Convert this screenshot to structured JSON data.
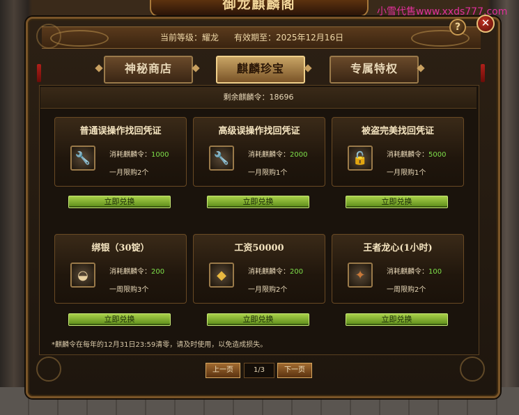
{
  "game": {
    "title": "御龙麒麟阁",
    "watermark": "小雪代售www.xxds777.com"
  },
  "header": {
    "level_label": "当前等级：耀龙",
    "expiry_label": "有效期至：2025年12月16日"
  },
  "tabs": [
    {
      "label": "神秘商店",
      "active": false
    },
    {
      "label": "麒麟珍宝",
      "active": true
    },
    {
      "label": "专属特权",
      "active": false
    }
  ],
  "remaining": "剩余麒麟令：18696",
  "items": [
    {
      "name": "普通误操作找回凭证",
      "cost_label": "消耗麒麟令：",
      "cost": "1000",
      "limit": "一月限购2个",
      "icon": "wrench-icon",
      "button": "立即兑换"
    },
    {
      "name": "高级误操作找回凭证",
      "cost_label": "消耗麒麟令：",
      "cost": "2000",
      "limit": "一月限购1个",
      "icon": "wrench-icon",
      "button": "立即兑换"
    },
    {
      "name": "被盗完美找回凭证",
      "cost_label": "消耗麒麟令：",
      "cost": "5000",
      "limit": "一月限购1个",
      "icon": "lock-icon",
      "button": "立即兑换"
    },
    {
      "name": "绑银（30锭）",
      "cost_label": "消耗麒麟令：",
      "cost": "200",
      "limit": "一周限购3个",
      "icon": "silver-ingot-icon",
      "button": "立即兑换"
    },
    {
      "name": "工资50000",
      "cost_label": "消耗麒麟令：",
      "cost": "200",
      "limit": "一月限购2个",
      "icon": "gold-pouch-icon",
      "button": "立即兑换"
    },
    {
      "name": "王者龙心(1小时)",
      "cost_label": "消耗麒麟令：",
      "cost": "100",
      "limit": "一周限购2个",
      "icon": "dragon-heart-icon",
      "button": "立即兑换"
    }
  ],
  "note": "*麒麟令在每年的12月31日23:59清零，请及时使用，以免造成损失。",
  "pagination": {
    "prev": "上一页",
    "page": "1/3",
    "next": "下一页"
  },
  "controls": {
    "help": "?",
    "close": "✕"
  }
}
